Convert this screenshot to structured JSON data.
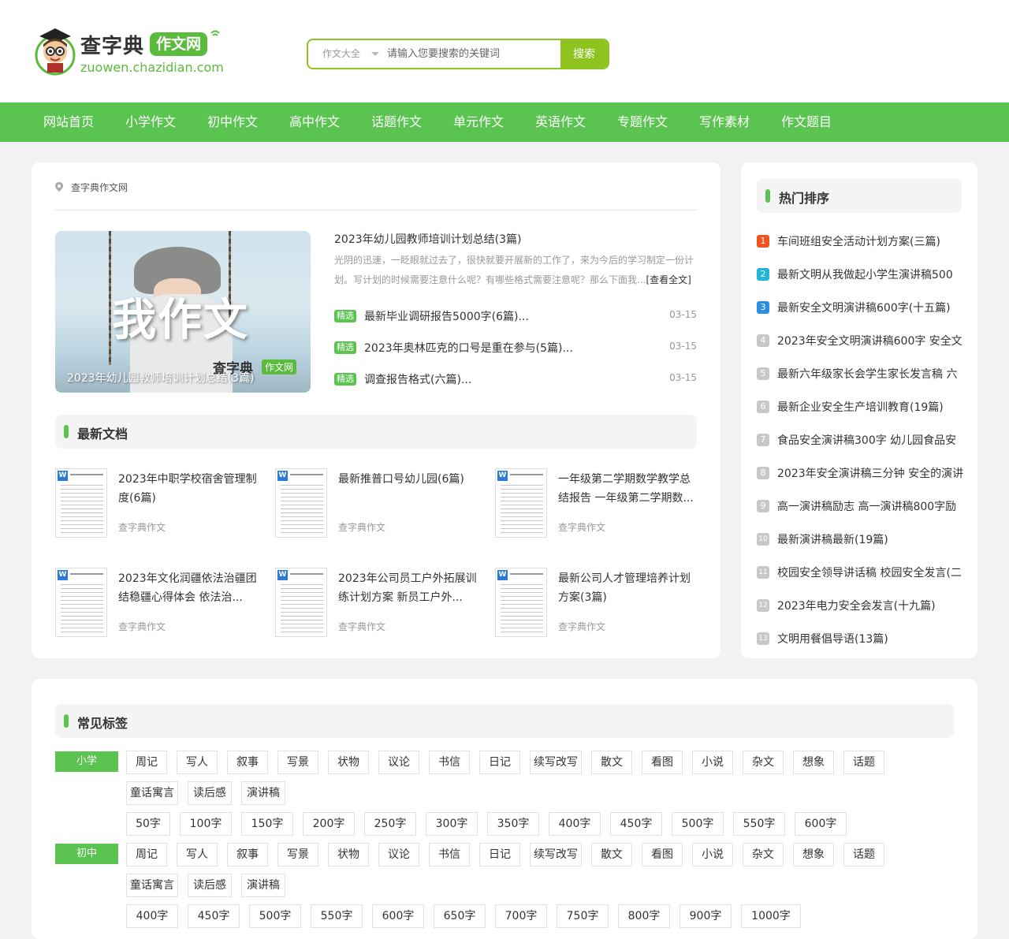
{
  "header": {
    "logo_title": "查字典",
    "logo_badge": "作文网",
    "logo_url": "zuowen.chazidian.com",
    "search": {
      "select_value": "作文大全",
      "placeholder": "请输入您要搜索的关键词",
      "button": "搜索"
    }
  },
  "nav": [
    "网站首页",
    "小学作文",
    "初中作文",
    "高中作文",
    "话题作文",
    "单元作文",
    "英语作文",
    "专题作文",
    "写作素材",
    "作文题目"
  ],
  "breadcrumb": "查字典作文网",
  "feature": {
    "image_text": "我作文",
    "image_caption": "2023年幼儿园教师培训计划总结(3篇)",
    "image_watermark": "查字典",
    "image_watermark_badge": "作文网",
    "title": "2023年幼儿园教师培训计划总结(3篇)",
    "desc": "光阴的迅速，一眨眼就过去了，很快就要开展新的工作了，来为今后的学习制定一份计划。写计划的时候需要注意什么呢？有哪些格式需要注意呢？那么下面我...",
    "more": "[查看全文]"
  },
  "picks": [
    {
      "tag": "精选",
      "title": "最新毕业调研报告5000字(6篇)...",
      "date": "03-15"
    },
    {
      "tag": "精选",
      "title": "2023年奥林匹克的口号是重在参与(5篇)...",
      "date": "03-15"
    },
    {
      "tag": "精选",
      "title": "调查报告格式(六篇)...",
      "date": "03-15"
    }
  ],
  "latest": {
    "title": "最新文档",
    "docs": [
      {
        "title": "2023年中职学校宿舍管理制度(6篇)",
        "source": "查字典作文"
      },
      {
        "title": "最新推普口号幼儿园(6篇)",
        "source": "查字典作文"
      },
      {
        "title": "一年级第二学期数学教学总结报告 一年级第二学期数...",
        "source": "查字典作文"
      },
      {
        "title": "2023年文化润疆依法治疆团结稳疆心得体会 依法治...",
        "source": "查字典作文"
      },
      {
        "title": "2023年公司员工户外拓展训练计划方案 新员工户外...",
        "source": "查字典作文"
      },
      {
        "title": "最新公司人才管理培养计划方案(3篇)",
        "source": "查字典作文"
      }
    ]
  },
  "hot": {
    "title": "热门排序",
    "items": [
      {
        "num": "1",
        "title": "车间班组安全活动计划方案(三篇)"
      },
      {
        "num": "2",
        "title": "最新文明从我做起小学生演讲稿500"
      },
      {
        "num": "3",
        "title": "最新安全文明演讲稿600字(十五篇)"
      },
      {
        "num": "4",
        "title": "2023年安全文明演讲稿600字 安全文"
      },
      {
        "num": "5",
        "title": "最新六年级家长会学生家长发言稿 六"
      },
      {
        "num": "6",
        "title": "最新企业安全生产培训教育(19篇)"
      },
      {
        "num": "7",
        "title": "食品安全演讲稿300字 幼儿园食品安"
      },
      {
        "num": "8",
        "title": "2023年安全演讲稿三分钟 安全的演讲"
      },
      {
        "num": "9",
        "title": "高一演讲稿励志 高一演讲稿800字励"
      },
      {
        "num": "10",
        "title": "最新演讲稿最新(19篇)"
      },
      {
        "num": "11",
        "title": "校园安全领导讲话稿 校园安全发言(二"
      },
      {
        "num": "12",
        "title": "2023年电力安全会发言(十九篇)"
      },
      {
        "num": "13",
        "title": "文明用餐倡导语(13篇)"
      }
    ],
    "colors": {
      "1": "#f0541e",
      "2": "#1fb5d6",
      "3": "#2d8fe0"
    }
  },
  "tags": {
    "title": "常见标签",
    "groups": [
      {
        "level": "小学",
        "types": [
          "周记",
          "写人",
          "叙事",
          "写景",
          "状物",
          "议论",
          "书信",
          "日记",
          "续写改写",
          "散文",
          "看图",
          "小说",
          "杂文",
          "想象",
          "话题"
        ],
        "types2": [
          "童话寓言",
          "读后感",
          "演讲稿"
        ],
        "counts": [
          "50字",
          "100字",
          "150字",
          "200字",
          "250字",
          "300字",
          "350字",
          "400字",
          "450字",
          "500字",
          "550字",
          "600字"
        ]
      },
      {
        "level": "初中",
        "types": [
          "周记",
          "写人",
          "叙事",
          "写景",
          "状物",
          "议论",
          "书信",
          "日记",
          "续写改写",
          "散文",
          "看图",
          "小说",
          "杂文",
          "想象",
          "话题"
        ],
        "types2": [
          "童话寓言",
          "读后感",
          "演讲稿"
        ],
        "counts": [
          "400字",
          "450字",
          "500字",
          "550字",
          "600字",
          "650字",
          "700字",
          "750字",
          "800字",
          "900字",
          "1000字"
        ]
      }
    ]
  },
  "accent": "#5bc451"
}
